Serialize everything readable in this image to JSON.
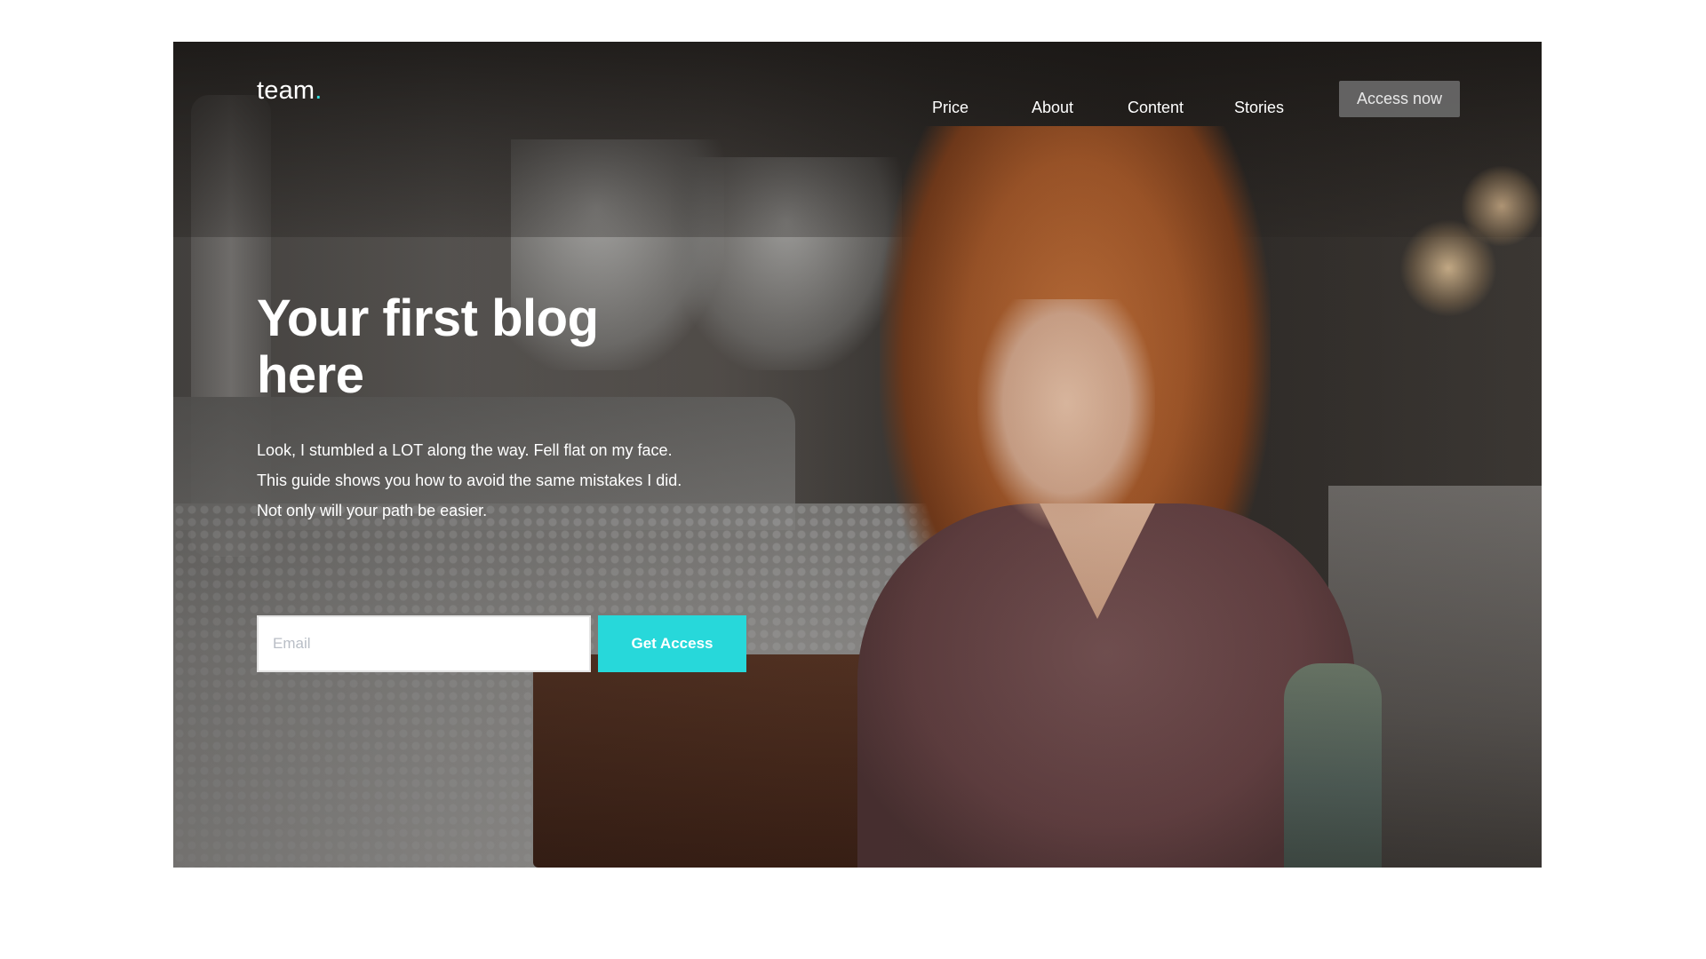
{
  "brand": {
    "name": "team",
    "dot": ".",
    "accent_color": "#2fe0e2"
  },
  "nav": {
    "items": [
      {
        "label": "Price"
      },
      {
        "label": "About"
      },
      {
        "label": "Content"
      },
      {
        "label": "Stories"
      }
    ],
    "cta_label": "Access now"
  },
  "hero": {
    "headline_line1": "Your first blog",
    "headline_line2": "here",
    "body_lines": [
      "Look, I stumbled a LOT along the way. Fell flat on my face.",
      "This guide shows you how to avoid the same mistakes I did.",
      "Not only will your path be easier."
    ],
    "email_placeholder": "Email",
    "email_value": "",
    "submit_label": "Get Access",
    "submit_color": "#27d8da"
  }
}
